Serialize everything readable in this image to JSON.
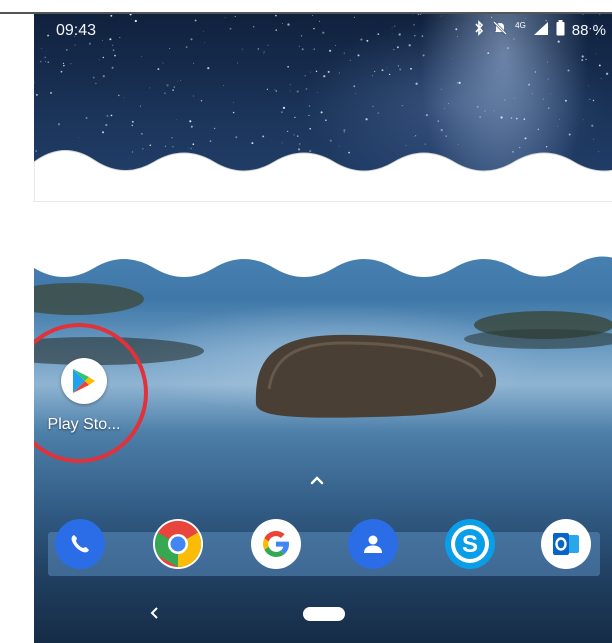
{
  "status_bar": {
    "time": "09:43",
    "network_label": "4G",
    "battery_percent": "88 %"
  },
  "apps": [
    {
      "label": "Play Sto...",
      "icon": "play-store-icon"
    }
  ],
  "dock": [
    {
      "icon": "phone-icon",
      "color": "#2b6de6"
    },
    {
      "icon": "chrome-icon",
      "color": "#e8453c"
    },
    {
      "icon": "google-icon",
      "color": "#ffffff"
    },
    {
      "icon": "contacts-icon",
      "color": "#2b6de6"
    },
    {
      "icon": "skype-icon",
      "color": "#0a9ee8"
    },
    {
      "icon": "outlook-icon",
      "color": "#ffffff"
    }
  ],
  "navigation": {
    "back": "back-icon",
    "home": "home-pill"
  },
  "colors": {
    "highlight_ring": "#e0323a"
  }
}
